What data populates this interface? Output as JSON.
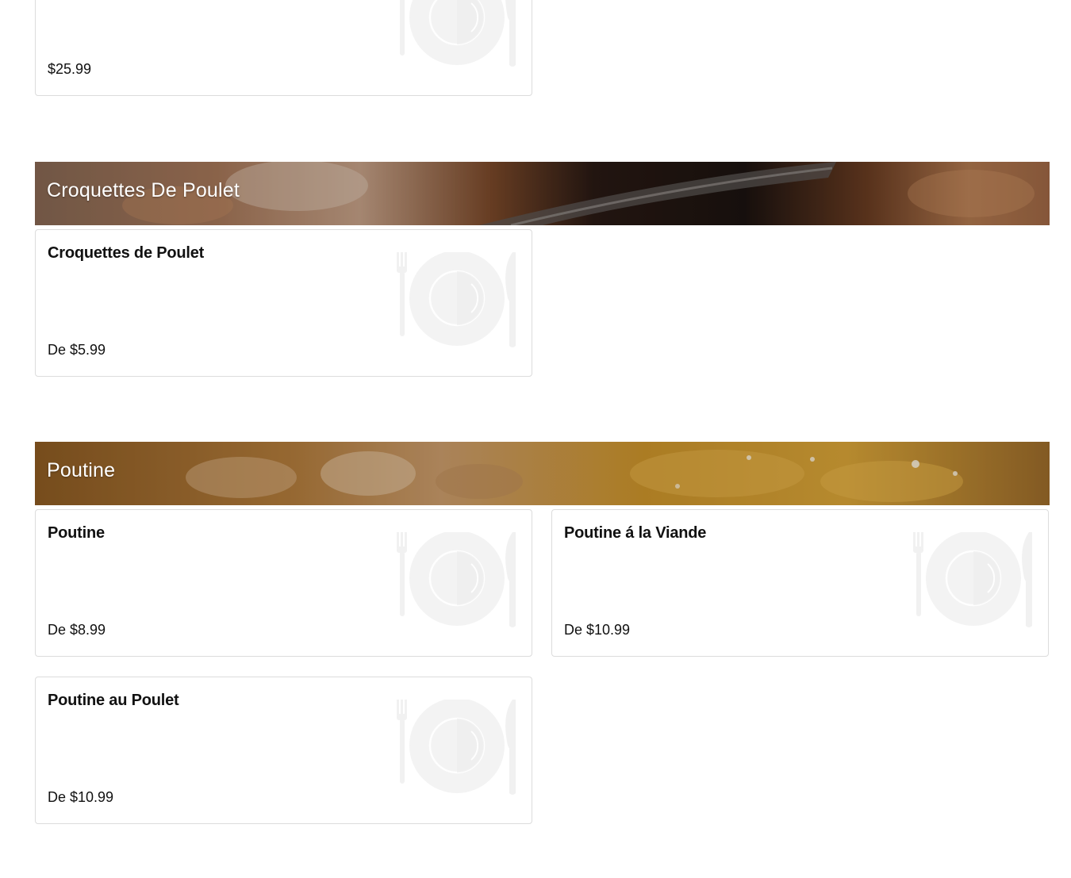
{
  "top_card": {
    "price": "$25.99",
    "icon": "plate-icon"
  },
  "sections": [
    {
      "title": "Croquettes De Poulet",
      "items": [
        {
          "name": "Croquettes de Poulet",
          "price": "De $5.99"
        }
      ]
    },
    {
      "title": "Poutine",
      "items": [
        {
          "name": "Poutine",
          "price": "De $8.99"
        },
        {
          "name": "Poutine á la Viande",
          "price": "De $10.99"
        },
        {
          "name": "Poutine au Poulet",
          "price": "De $10.99"
        }
      ]
    }
  ],
  "colors": {
    "card_border": "#dcdcdc",
    "placeholder_icon": "#f3f3f3",
    "banner_text": "#ffffff"
  }
}
